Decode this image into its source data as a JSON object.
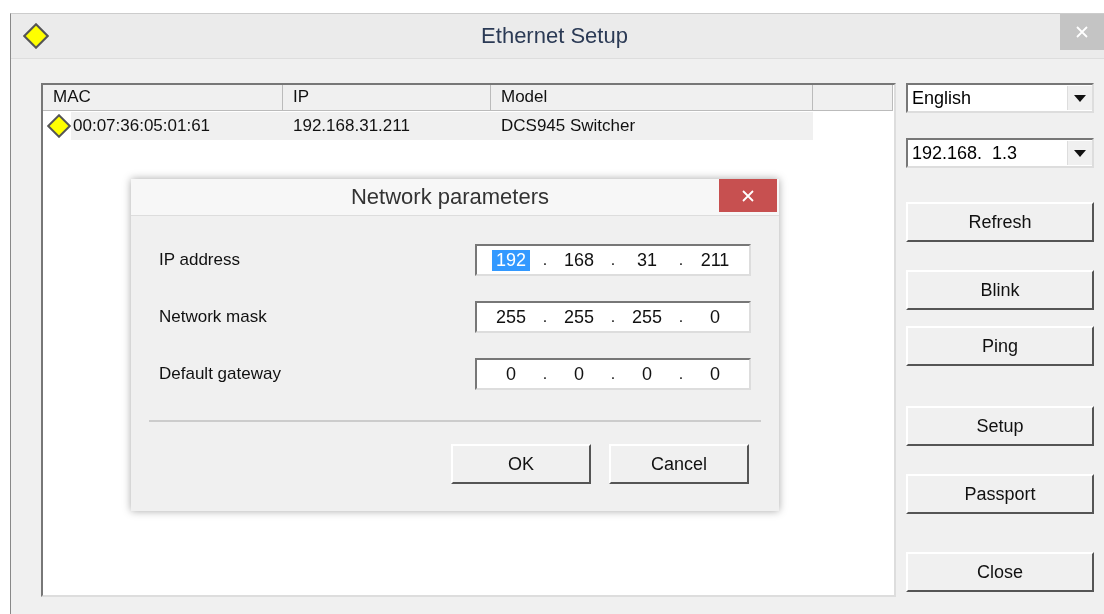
{
  "window": {
    "title": "Ethernet Setup"
  },
  "device_list": {
    "columns": [
      "MAC",
      "IP",
      "Model"
    ],
    "rows": [
      {
        "selected": true,
        "cells": [
          "00:07:36:05:01:61",
          "192.168.31.211",
          "DCS945 Switcher"
        ]
      }
    ]
  },
  "language_select": {
    "value": "English"
  },
  "address_select": {
    "value": "192.168.  1.3"
  },
  "buttons": [
    "Refresh",
    "Blink",
    "Ping",
    "Setup",
    "Passport",
    "Close"
  ],
  "dialog": {
    "title": "Network parameters",
    "fields": [
      {
        "label": "IP address",
        "octets": [
          {
            "value": "192",
            "selected": true
          },
          {
            "value": "168",
            "selected": false
          },
          {
            "value": "31",
            "selected": false
          },
          {
            "value": "211",
            "selected": false
          }
        ]
      },
      {
        "label": "Network mask",
        "octets": [
          {
            "value": "255",
            "selected": false
          },
          {
            "value": "255",
            "selected": false
          },
          {
            "value": "255",
            "selected": false
          },
          {
            "value": "0",
            "selected": false
          }
        ]
      },
      {
        "label": "Default gateway",
        "octets": [
          {
            "value": "0",
            "selected": false
          },
          {
            "value": "0",
            "selected": false
          },
          {
            "value": "0",
            "selected": false
          },
          {
            "value": "0",
            "selected": false
          }
        ]
      }
    ],
    "separator": ".",
    "buttons": [
      "OK",
      "Cancel"
    ]
  }
}
